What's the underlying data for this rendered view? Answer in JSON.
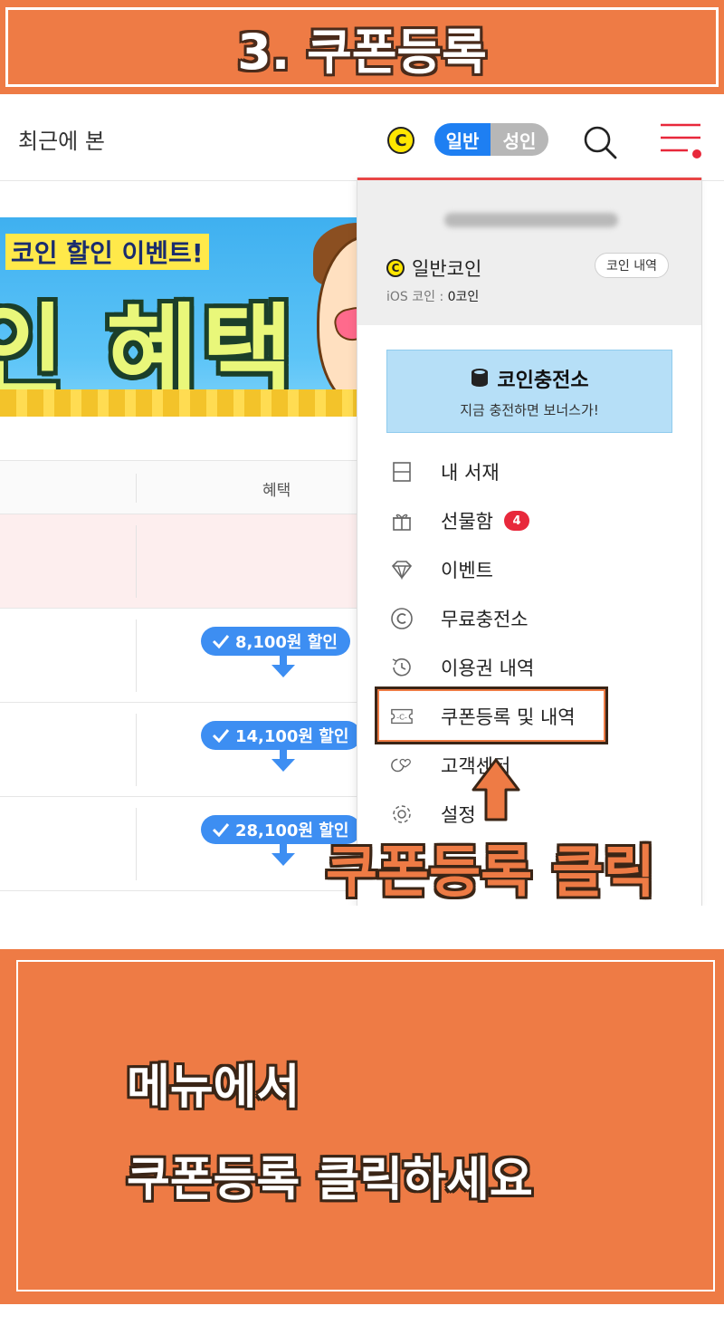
{
  "title_banner": {
    "text": "3. 쿠폰등록"
  },
  "topbar": {
    "recent_label": "최근에 본",
    "coin_symbol": "C",
    "mode_general": "일반",
    "mode_adult": "성인"
  },
  "promo_banner": {
    "line1": "코인 할인 이벤트!",
    "line2": "인 혜택"
  },
  "table": {
    "benefit_header": "혜택",
    "rows": [
      {
        "discount": "8,100원 할인"
      },
      {
        "discount": "14,100원 할인"
      },
      {
        "discount": "28,100원 할인"
      }
    ]
  },
  "menu_panel": {
    "coin_symbol": "C",
    "coin_label": "일반코인",
    "coin_history_button": "코인 내역",
    "ios_coin_label": "iOS 코인 :",
    "ios_coin_value": "0코인",
    "charge_title": "코인충전소",
    "charge_sub": "지금 충전하면 보너스가!",
    "items": [
      {
        "label": "내 서재",
        "icon": "bookshelf-icon"
      },
      {
        "label": "선물함",
        "icon": "gift-icon",
        "badge": "4"
      },
      {
        "label": "이벤트",
        "icon": "diamond-icon"
      },
      {
        "label": "무료충전소",
        "icon": "copyright-coin-icon"
      },
      {
        "label": "이용권 내역",
        "icon": "clock-history-icon"
      },
      {
        "label": "쿠폰등록 및 내역",
        "icon": "coupon-icon"
      },
      {
        "label": "고객센터",
        "icon": "customer-heart-icon"
      },
      {
        "label": "설정",
        "icon": "settings-gear-icon"
      }
    ]
  },
  "annotation": {
    "click_label": "쿠폰등록 클릭"
  },
  "instruction": {
    "line1": "메뉴에서",
    "line2": "쿠폰등록 클릭하세요"
  },
  "colors": {
    "orange": "#ee7b45",
    "blue": "#1e7ff2",
    "badge_red": "#e8283b"
  }
}
